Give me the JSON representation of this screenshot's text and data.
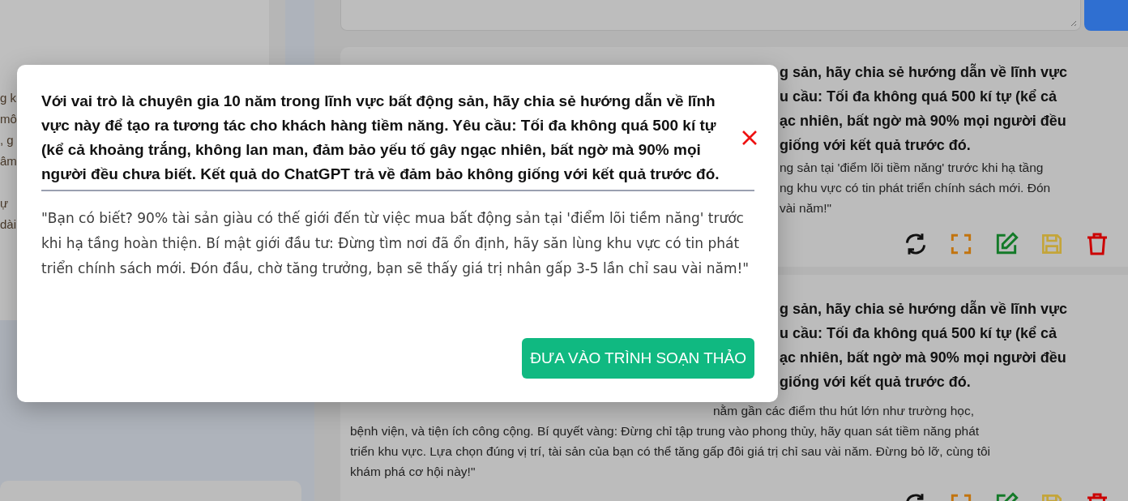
{
  "left_panel": {
    "fragment_groups": [
      [
        "g k",
        "mô",
        ", g",
        "âm"
      ],
      [
        "ự",
        "dài"
      ]
    ]
  },
  "cards": [
    {
      "title_lines": [
        "g sản, hãy chia sẻ hướng dẫn về lĩnh vực",
        "u cầu: Tối đa không quá 500 kí tự (kể cả",
        "ạc nhiên, bất ngờ mà 90% mọi người đều",
        "giống với kết quả trước đó."
      ],
      "body_lines": [
        "ng sản tại 'điểm lõi tiềm năng' trước khi hạ tầng",
        "ng khu vực có tin phát triển chính sách mới. Đón",
        "vài năm!\""
      ],
      "actions": [
        {
          "kind": "refresh"
        },
        {
          "kind": "expand"
        },
        {
          "kind": "edit"
        },
        {
          "kind": "save"
        },
        {
          "kind": "delete"
        }
      ]
    },
    {
      "title_lines": [
        "g sản, hãy chia sẻ hướng dẫn về lĩnh vực",
        "u cầu: Tối đa không quá 500 kí tự (kể cả",
        "ạc nhiên, bất ngờ mà 90% mọi người đều",
        "giống với kết quả trước đó."
      ],
      "body_lines": [
        "nằm gần các điểm thu hút lớn như trường học,",
        "bệnh viện, và tiện ích công cộng. Bí quyết vàng: Đừng chỉ tập trung vào phong thủy, hãy quan sát tiềm năng phát",
        "triển khu vực. Lựa chọn đúng vị trí, tài sản của bạn có thể tăng gấp đôi giá trị chỉ sau vài năm. Đừng bỏ lỡ, cùng tôi",
        "khám phá cơ hội này!\""
      ],
      "actions": [
        {
          "kind": "refresh"
        },
        {
          "kind": "expand"
        },
        {
          "kind": "edit"
        },
        {
          "kind": "save"
        },
        {
          "kind": "delete"
        }
      ]
    }
  ],
  "modal": {
    "title": "Với vai trò là chuyên gia 10 năm trong lĩnh vực bất động sản, hãy chia sẻ hướng dẫn về lĩnh vực này để tạo ra tương tác cho khách hàng tiềm năng. Yêu cầu: Tối đa không quá 500 kí tự (kể cả khoảng trắng, không lan man, đảm bảo yếu tố gây ngạc nhiên, bất ngờ mà 90% mọi người đều chưa biết. Kết quả do ChatGPT trả về đảm bảo không giống với kết quả trước đó.",
    "body": "\"Bạn có biết? 90% tài sản giàu có thế giới đến từ việc mua bất động sản tại 'điểm lõi tiềm năng' trước khi hạ tầng hoàn thiện. Bí mật giới đầu tư: Đừng tìm nơi đã ổn định, hãy săn lùng khu vực có tin phát triển chính sách mới. Đón đầu, chờ tăng trưởng, bạn sẽ thấy giá trị nhân gấp 3-5 lần chỉ sau vài năm!\"",
    "button": "ĐƯA VÀO TRÌNH SOẠN THẢO"
  }
}
